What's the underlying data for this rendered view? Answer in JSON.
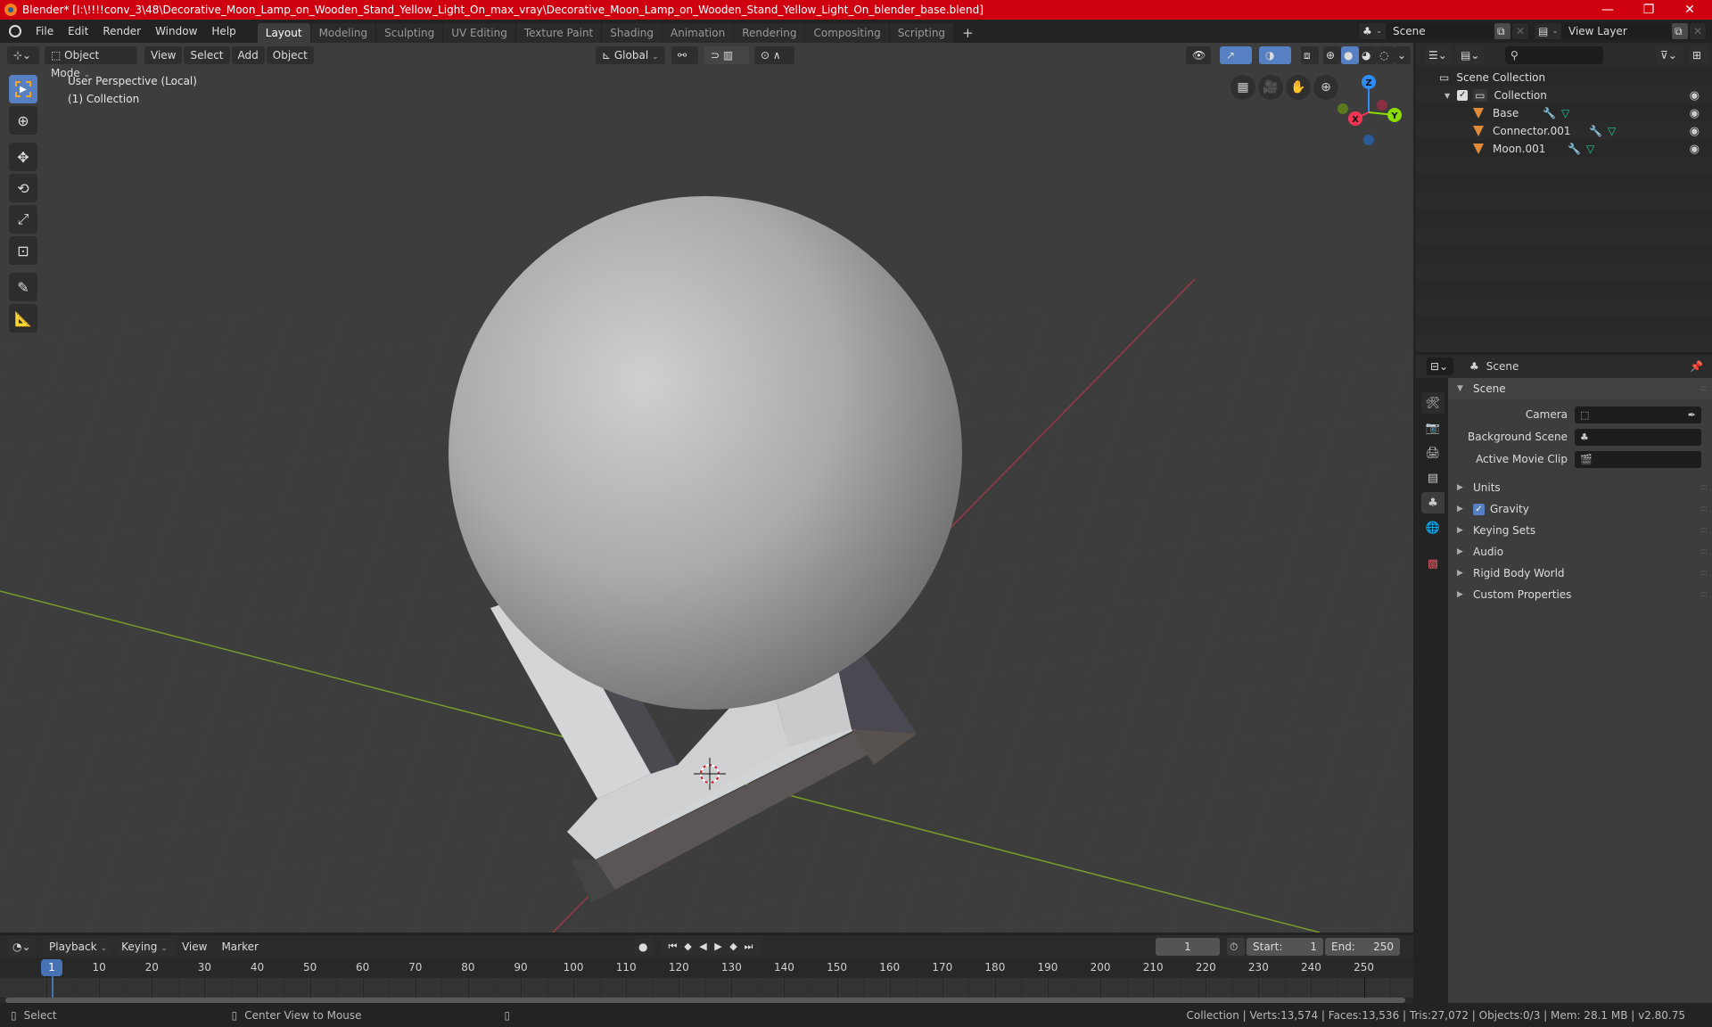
{
  "titlebar": {
    "title": "Blender* [I:\\!!!!conv_3\\48\\Decorative_Moon_Lamp_on_Wooden_Stand_Yellow_Light_On_max_vray\\Decorative_Moon_Lamp_on_Wooden_Stand_Yellow_Light_On_blender_base.blend]",
    "minimize": "—",
    "maximize": "❐",
    "close": "✕"
  },
  "menu": [
    "File",
    "Edit",
    "Render",
    "Window",
    "Help"
  ],
  "workspaces": [
    {
      "label": "Layout",
      "active": true
    },
    {
      "label": "Modeling"
    },
    {
      "label": "Sculpting"
    },
    {
      "label": "UV Editing"
    },
    {
      "label": "Texture Paint"
    },
    {
      "label": "Shading"
    },
    {
      "label": "Animation"
    },
    {
      "label": "Rendering"
    },
    {
      "label": "Compositing"
    },
    {
      "label": "Scripting"
    }
  ],
  "add_workspace": "+",
  "scene_selector": {
    "value": "Scene"
  },
  "viewlayer_selector": {
    "value": "View Layer"
  },
  "viewport": {
    "mode": "Object Mode",
    "menus": [
      "View",
      "Select",
      "Add",
      "Object"
    ],
    "orientation": "Global",
    "overlay_line1": "User Perspective (Local)",
    "overlay_line2": "(1) Collection",
    "gizmo": {
      "x": "X",
      "y": "Y",
      "z": "Z"
    }
  },
  "outliner": {
    "search_placeholder": "",
    "scene_collection": "Scene Collection",
    "collection": "Collection",
    "objects": [
      {
        "name": "Base"
      },
      {
        "name": "Connector.001"
      },
      {
        "name": "Moon.001"
      }
    ]
  },
  "properties": {
    "context": "Scene",
    "panel_title": "Scene",
    "fields": [
      {
        "label": "Camera",
        "value": ""
      },
      {
        "label": "Background Scene",
        "value": ""
      },
      {
        "label": "Active Movie Clip",
        "value": ""
      }
    ],
    "subpanels": [
      {
        "label": "Units"
      },
      {
        "label": "Gravity",
        "checkbox": true
      },
      {
        "label": "Keying Sets"
      },
      {
        "label": "Audio"
      },
      {
        "label": "Rigid Body World"
      },
      {
        "label": "Custom Properties"
      }
    ]
  },
  "timeline": {
    "menus": [
      "Playback",
      "Keying",
      "View",
      "Marker"
    ],
    "current_frame": "1",
    "start_label": "Start:",
    "start": "1",
    "end_label": "End:",
    "end": "250",
    "ruler": [
      "1",
      "10",
      "20",
      "30",
      "40",
      "50",
      "60",
      "70",
      "80",
      "90",
      "100",
      "110",
      "120",
      "130",
      "140",
      "150",
      "160",
      "170",
      "180",
      "190",
      "200",
      "210",
      "220",
      "230",
      "240",
      "250"
    ]
  },
  "statusbar": {
    "select": "Select",
    "center_view": "Center View to Mouse",
    "stats": "Collection | Verts:13,574 | Faces:13,536 | Tris:27,072 | Objects:0/3 | Mem: 28.1 MB | v2.80.75"
  },
  "colors": {
    "titlebar": "#cf0010",
    "accent": "#5680c2",
    "x_axis": "#f43655",
    "y_axis": "#8bdc00",
    "z_axis": "#2d8cf5",
    "object_icon": "#e08a3a",
    "modifier_icon": "#6b9ae8",
    "mesh_icon": "#1ec8a0"
  }
}
